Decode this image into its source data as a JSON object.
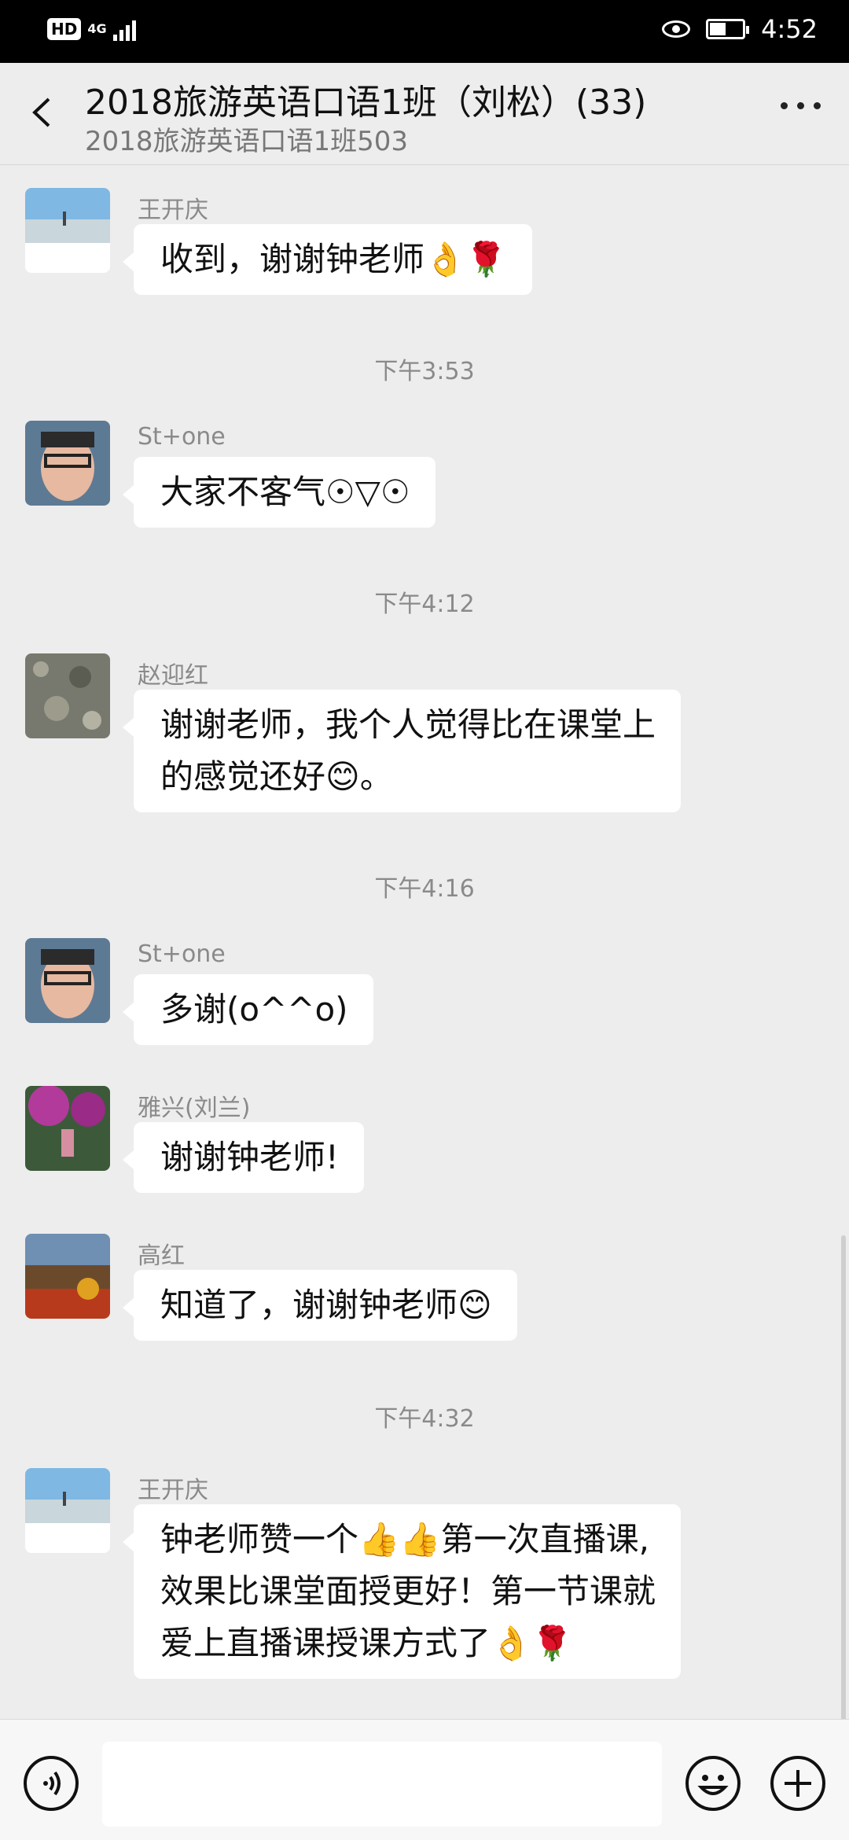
{
  "status_bar": {
    "hd": "HD",
    "network": "4G",
    "time": "4:52"
  },
  "header": {
    "title": "2018旅游英语口语1班（刘松）(33)",
    "subtitle": "2018旅游英语口语1班503"
  },
  "messages": [
    {
      "sender": "王开庆",
      "text": "收到，谢谢钟老师👌🌹"
    },
    {
      "time": "下午3:53"
    },
    {
      "sender": "St+one",
      "text": "大家不客气☉▽☉"
    },
    {
      "time": "下午4:12"
    },
    {
      "sender": "赵迎红",
      "line1": "谢谢老师，我个人觉得比在课堂上",
      "line2": "的感觉还好😊。"
    },
    {
      "time": "下午4:16"
    },
    {
      "sender": "St+one",
      "text": "多谢(o^^o)"
    },
    {
      "sender": "雅兴(刘兰)",
      "text": "谢谢钟老师!"
    },
    {
      "sender": "高红",
      "text": "知道了，谢谢钟老师😊"
    },
    {
      "time": "下午4:32"
    },
    {
      "sender": "王开庆",
      "line1": "钟老师赞一个👍👍第一次直播课,",
      "line2": "效果比课堂面授更好！第一节课就",
      "line3": "爱上直播课授课方式了👌🌹"
    }
  ],
  "colors": {
    "background": "#ededed",
    "bubble": "#ffffff",
    "status_bar": "#000000"
  },
  "icons": [
    "back-arrow-icon",
    "more-icon",
    "voice-icon",
    "emoji-icon",
    "plus-icon"
  ]
}
